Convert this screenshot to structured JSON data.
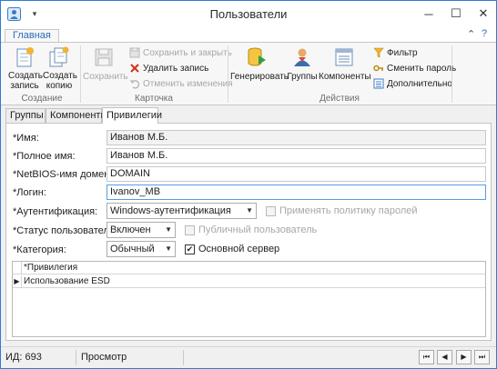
{
  "window": {
    "title": "Пользователи",
    "minimize_glyph": "─",
    "maximize_glyph": "☐",
    "close_glyph": "✕",
    "quick_access_glyph": "▾"
  },
  "ribbon": {
    "tab_main": "Главная",
    "help_glyph": "?",
    "collapse_glyph": "⌃",
    "groups": {
      "create": "Создание",
      "card": "Карточка",
      "actions": "Действия"
    },
    "buttons": {
      "create_record": [
        "Создать",
        "запись"
      ],
      "create_copy": [
        "Создать",
        "копию"
      ],
      "save": "Сохранить",
      "save_close": "Сохранить и закрыть",
      "delete_record": "Удалить запись",
      "cancel_changes": "Отменить изменения",
      "generate": "Генерировать",
      "groups": "Группы",
      "components": "Компоненты",
      "filter": "Фильтр",
      "change_password": "Сменить пароль",
      "additional": "Дополнительно"
    }
  },
  "tabs": [
    "Группы",
    "Компоненты",
    "Привилегии"
  ],
  "form": {
    "name_label": "*Имя:",
    "name_value": "Иванов М.Б.",
    "fullname_label": "*Полное имя:",
    "fullname_value": "Иванов М.Б.",
    "netbios_label": "*NetBIOS-имя домена:",
    "netbios_value": "DOMAIN",
    "login_label": "*Логин:",
    "login_value": "Ivanov_MB",
    "auth_label": "*Аутентификация:",
    "auth_value": "Windows-аутентификация",
    "apply_policy_label": "Применять политику паролей",
    "status_label": "*Статус пользователя:",
    "status_value": "Включен",
    "public_user_label": "Публичный пользователь",
    "category_label": "*Категория:",
    "category_value": "Обычный",
    "main_server_label": "Основной сервер",
    "main_server_checked": true,
    "apply_policy_checked": false,
    "public_user_checked": false
  },
  "grid": {
    "column": "*Привилегия",
    "rows": [
      "Использование ESD"
    ]
  },
  "status": {
    "id": "ИД: 693",
    "mode": "Просмотр"
  },
  "nav": {
    "first": "⏮",
    "prev": "◀",
    "next": "▶",
    "last": "⏭"
  }
}
